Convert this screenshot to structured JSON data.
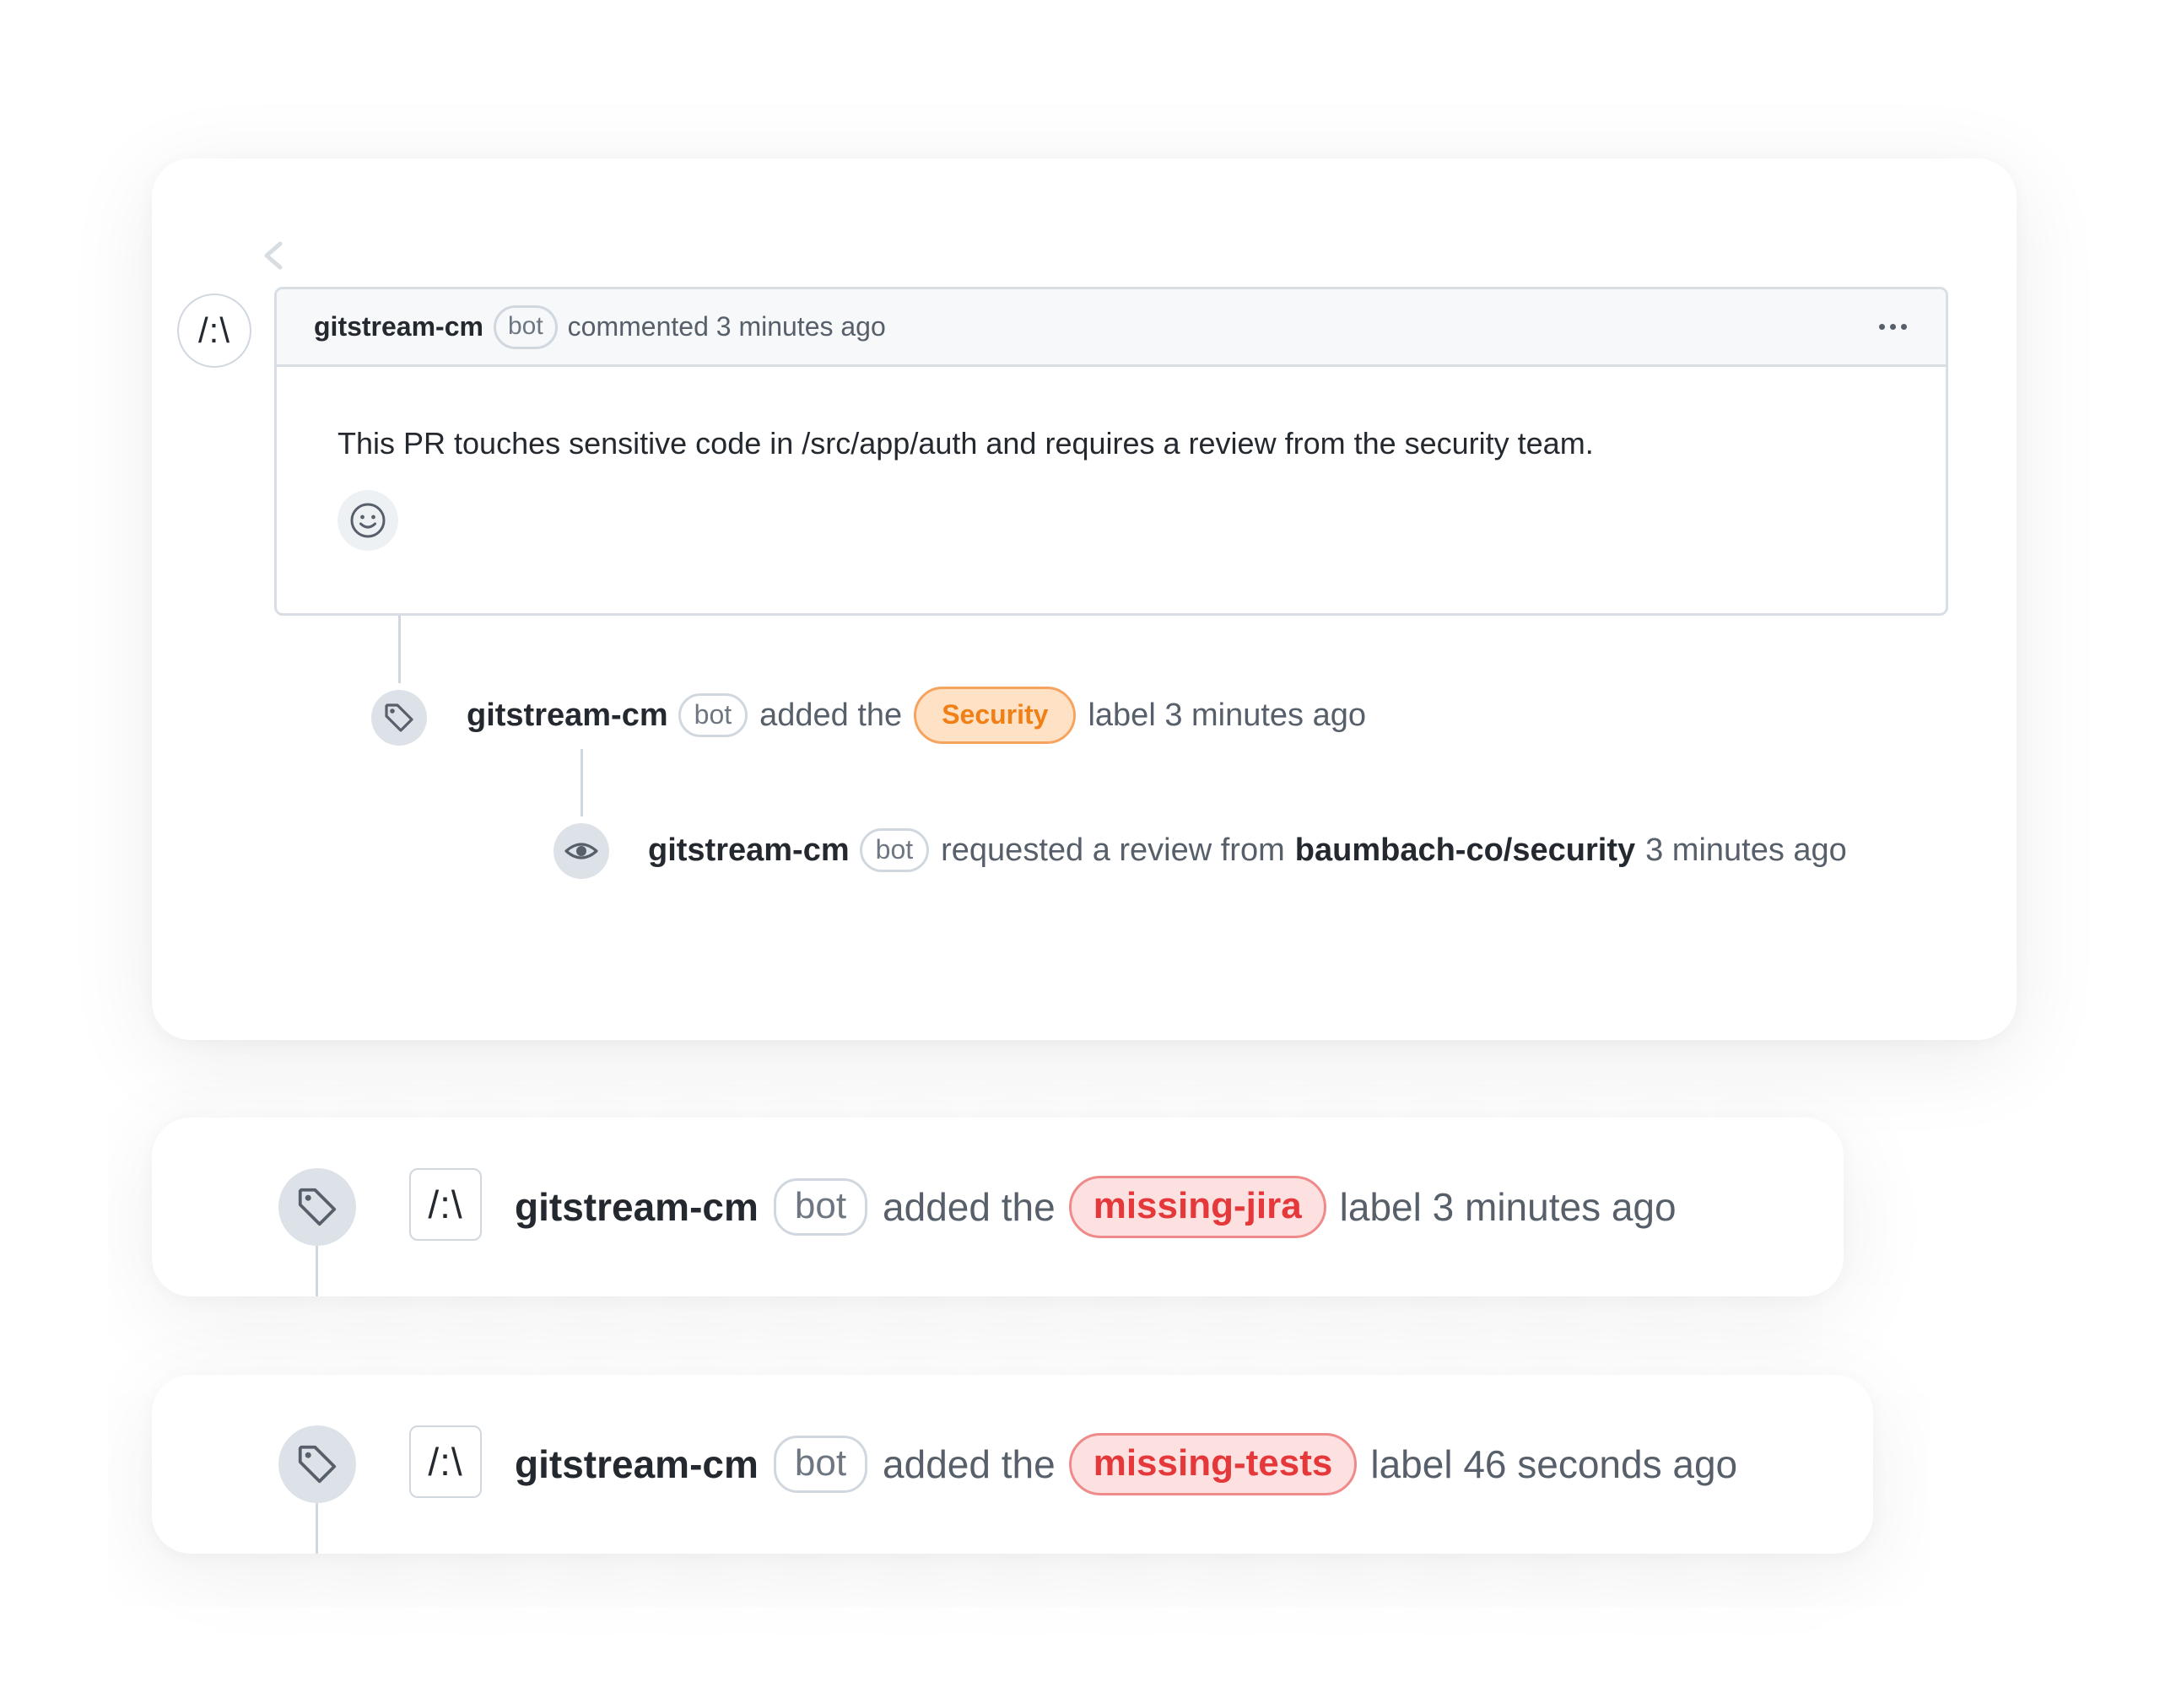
{
  "comment": {
    "author": "gitstream-cm",
    "badge": "bot",
    "action": "commented 3 minutes ago",
    "body": "This PR touches sensitive code in /src/app/auth and requires a review from the security team.",
    "avatar_text": "/:\\"
  },
  "timeline": [
    {
      "author": "gitstream-cm",
      "badge": "bot",
      "pre": "added the",
      "label": "Security",
      "post": "label 3 minutes ago"
    },
    {
      "author": "gitstream-cm",
      "badge": "bot",
      "pre": "requested a review from",
      "target": "baumbach-co/security",
      "post": "3 minutes ago"
    }
  ],
  "cards": [
    {
      "avatar_text": "/:\\",
      "author": "gitstream-cm",
      "badge": "bot",
      "pre": "added the",
      "label": "missing-jira",
      "post": "label 3 minutes ago"
    },
    {
      "avatar_text": "/:\\",
      "author": "gitstream-cm",
      "badge": "bot",
      "pre": "added the",
      "label": "missing-tests",
      "post": "label 46 seconds ago"
    }
  ],
  "colors": {
    "security_label": "#f07f15",
    "security_label_bg": "#ffe2c6",
    "missing_label": "#e5383b",
    "missing_label_bg": "#fde0e0"
  },
  "icons": [
    "chevron-left-icon",
    "kebab-icon",
    "smiley-icon",
    "tag-icon",
    "eye-icon"
  ]
}
